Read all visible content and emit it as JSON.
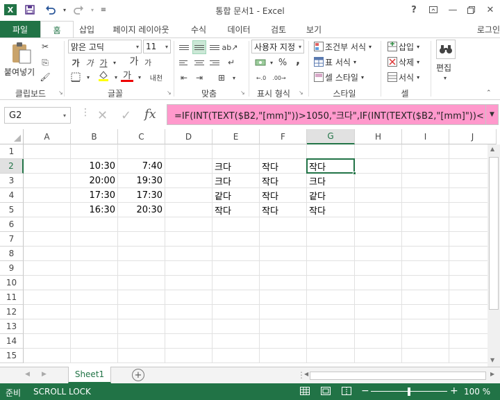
{
  "window": {
    "app_logo": "X",
    "title": "통합 문서1 - Excel",
    "help": "?"
  },
  "tabs": {
    "file": "파일",
    "home": "홈",
    "insert": "삽입",
    "page_layout": "페이지 레이아웃",
    "formulas": "수식",
    "data": "데이터",
    "review": "검토",
    "view": "보기",
    "login": "로그인"
  },
  "ribbon": {
    "clipboard": {
      "label": "클립보드",
      "paste": "붙여넣기"
    },
    "font": {
      "label": "글꼴",
      "font_name": "맑은 고딕",
      "font_size": "11",
      "bold": "가",
      "italic": "가",
      "underline": "가",
      "grow": "가",
      "shrink": "가",
      "color_letter": "가",
      "phonetic": "내천"
    },
    "alignment": {
      "label": "맞춤"
    },
    "number": {
      "label": "표시 형식",
      "format": "사용자 지정",
      "percent": "%",
      "comma": ","
    },
    "styles": {
      "label": "스타일",
      "conditional": "조건부 서식",
      "table": "표 서식",
      "cell_styles": "셀 스타일"
    },
    "cells": {
      "label": "셀",
      "insert": "삽입",
      "delete": "삭제",
      "format": "서식"
    },
    "editing": {
      "label": "편집"
    }
  },
  "formula_bar": {
    "name_box": "G2",
    "fx": "fx",
    "formula": "=IF(INT(TEXT($B2,\"[mm]\"))>1050,\"크다\",IF(INT(TEXT($B2,\"[mm]\"))<"
  },
  "grid": {
    "columns": [
      "A",
      "B",
      "C",
      "D",
      "E",
      "F",
      "G",
      "H",
      "I",
      "J"
    ],
    "rows": [
      "1",
      "2",
      "3",
      "4",
      "5",
      "6",
      "7",
      "8",
      "9",
      "10",
      "11",
      "12",
      "13",
      "14",
      "15"
    ],
    "data": [
      {
        "row": 2,
        "B": "10:30",
        "C": "7:40",
        "E": "크다",
        "F": "작다",
        "G": "작다"
      },
      {
        "row": 3,
        "B": "20:00",
        "C": "19:30",
        "E": "크다",
        "F": "작다",
        "G": "크다"
      },
      {
        "row": 4,
        "B": "17:30",
        "C": "17:30",
        "E": "같다",
        "F": "작다",
        "G": "같다"
      },
      {
        "row": 5,
        "B": "16:30",
        "C": "20:30",
        "E": "작다",
        "F": "작다",
        "G": "작다"
      }
    ]
  },
  "sheets": {
    "active": "Sheet1",
    "add": "+"
  },
  "status": {
    "ready": "준비",
    "scroll_lock": "SCROLL LOCK",
    "zoom": "100 %",
    "zoom_out": "−",
    "zoom_in": "+"
  },
  "colors": {
    "accent": "#217346",
    "formula_highlight": "#ff99cc"
  }
}
